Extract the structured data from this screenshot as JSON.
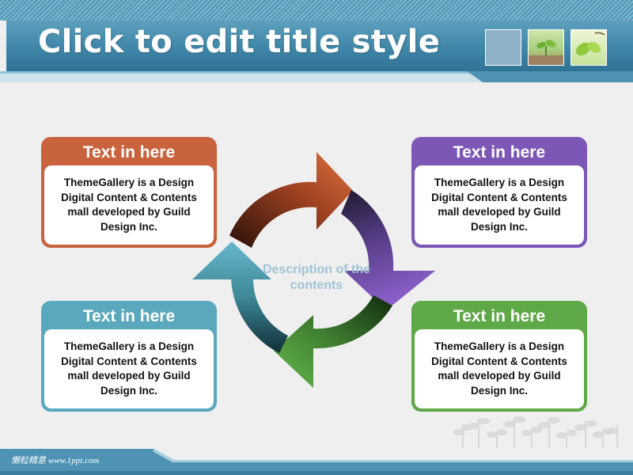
{
  "slide": {
    "title": "Click to edit title style",
    "center_description": "Description of the contents",
    "footer_text": "懒粒精意  www.1ppt.com"
  },
  "boxes": [
    {
      "id": "tl",
      "header": "Text in here",
      "body": "ThemeGallery is a Design Digital Content & Contents mall developed by Guild Design Inc.",
      "color": "#c8633d"
    },
    {
      "id": "tr",
      "header": "Text in here",
      "body": "ThemeGallery is a Design Digital Content & Contents mall developed by Guild Design Inc.",
      "color": "#7d57b6"
    },
    {
      "id": "bl",
      "header": "Text in here",
      "body": "ThemeGallery is a Design Digital Content & Contents mall developed by Guild Design Inc.",
      "color": "#5aa8bd"
    },
    {
      "id": "br",
      "header": "Text in here",
      "body": "ThemeGallery is a Design Digital Content & Contents mall developed by Guild Design Inc.",
      "color": "#5fa848"
    }
  ],
  "colors": {
    "title_band": "#3f86a8",
    "arrow_orange": "#d2683c",
    "arrow_purple": "#7d57b6",
    "arrow_green": "#5fa848",
    "arrow_teal": "#5aa8bd",
    "background": "#efefef"
  }
}
